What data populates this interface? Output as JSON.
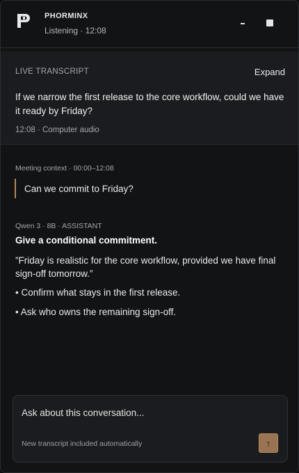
{
  "app": {
    "name": "PHORMINX",
    "status": "Listening · 12:08",
    "icons": {
      "logo": "phorminx-logo-icon",
      "minimize": "minimize-icon",
      "maximize": "maximize-icon"
    }
  },
  "live_transcript": {
    "label": "LIVE TRANSCRIPT",
    "expand_label": "Expand",
    "text": "If we narrow the first release to the core workflow, could we have it ready by Friday?",
    "meta": "12:08 · Computer audio"
  },
  "context": {
    "label": "Meeting context · 00:00–12:08",
    "question": "Can we commit to Friday?"
  },
  "assistant": {
    "label": "Qwen 3 · 8B · ASSISTANT",
    "title": "Give a conditional commitment.",
    "body": "”Friday is realistic for the core workflow, provided we have final sign-off tomorrow.”",
    "bullets": [
      "• Confirm what stays in the first release.",
      "• Ask who owns the remaining sign-off."
    ]
  },
  "composer": {
    "placeholder": "Ask about this conversation...",
    "hint": "New transcript included automatically",
    "send_icon": "arrow-up-icon"
  },
  "colors": {
    "background": "#111315",
    "panel": "#1a1c1f",
    "accent": "#b58a5e",
    "send_button": "#9a7452"
  }
}
